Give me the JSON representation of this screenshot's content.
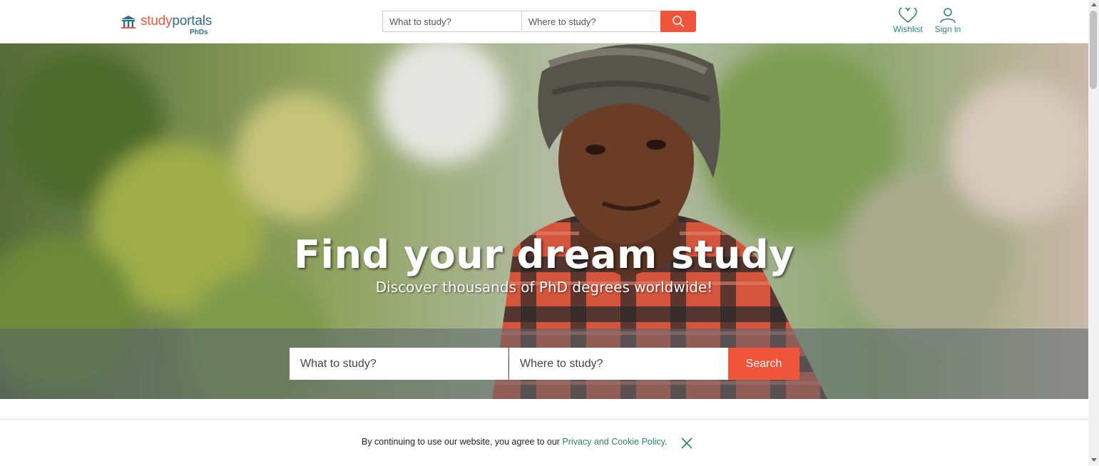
{
  "header": {
    "logo_word_part1": "study",
    "logo_word_part2": "portals",
    "logo_sub": "PhDs",
    "search": {
      "what_placeholder": "What to study?",
      "where_placeholder": "Where to study?"
    },
    "wishlist_label": "Wishlist",
    "signin_label": "Sign in"
  },
  "hero": {
    "title": "Find your dream study",
    "subtitle": "Discover thousands of PhD degrees worldwide!",
    "search": {
      "what_placeholder": "What to study?",
      "where_placeholder": "Where to study?",
      "button_label": "Search"
    }
  },
  "cookie_bar": {
    "text": "By continuing to use our website, you agree to our ",
    "link_text": "Privacy and Cookie Policy",
    "suffix": "."
  },
  "colors": {
    "accent": "#f0543a",
    "brand_blue": "#2d6d8a",
    "link_green": "#2d7f6e"
  },
  "icons": {
    "search": "search-icon",
    "wishlist": "heart-icon",
    "signin": "user-icon",
    "close": "close-icon",
    "logo": "pillar-building-icon"
  }
}
